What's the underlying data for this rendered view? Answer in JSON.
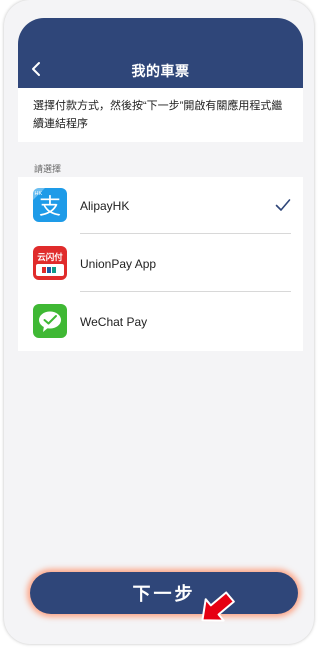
{
  "header": {
    "title": "我的車票"
  },
  "instruction": "選擇付款方式，然後按“下一步”開啟有關應用程式繼續連結程序",
  "section_label": "請選擇",
  "payment_methods": [
    {
      "name": "AlipayHK",
      "icon": "alipayhk-logo",
      "selected": true
    },
    {
      "name": "UnionPay App",
      "icon": "unionpay-logo",
      "selected": false
    },
    {
      "name": "WeChat Pay",
      "icon": "wechat-pay-logo",
      "selected": false
    }
  ],
  "logo_text": {
    "alipay_badge": "HK",
    "alipay_char": "支",
    "unionpay": "云闪付"
  },
  "next_button": "下一步",
  "colors": {
    "header": "#2f4679",
    "alipay": "#1e9be8",
    "unionpay": "#e02b2b",
    "wechat": "#3fb834",
    "button_glow": "#ff8c64",
    "pointer": "#e60012"
  }
}
